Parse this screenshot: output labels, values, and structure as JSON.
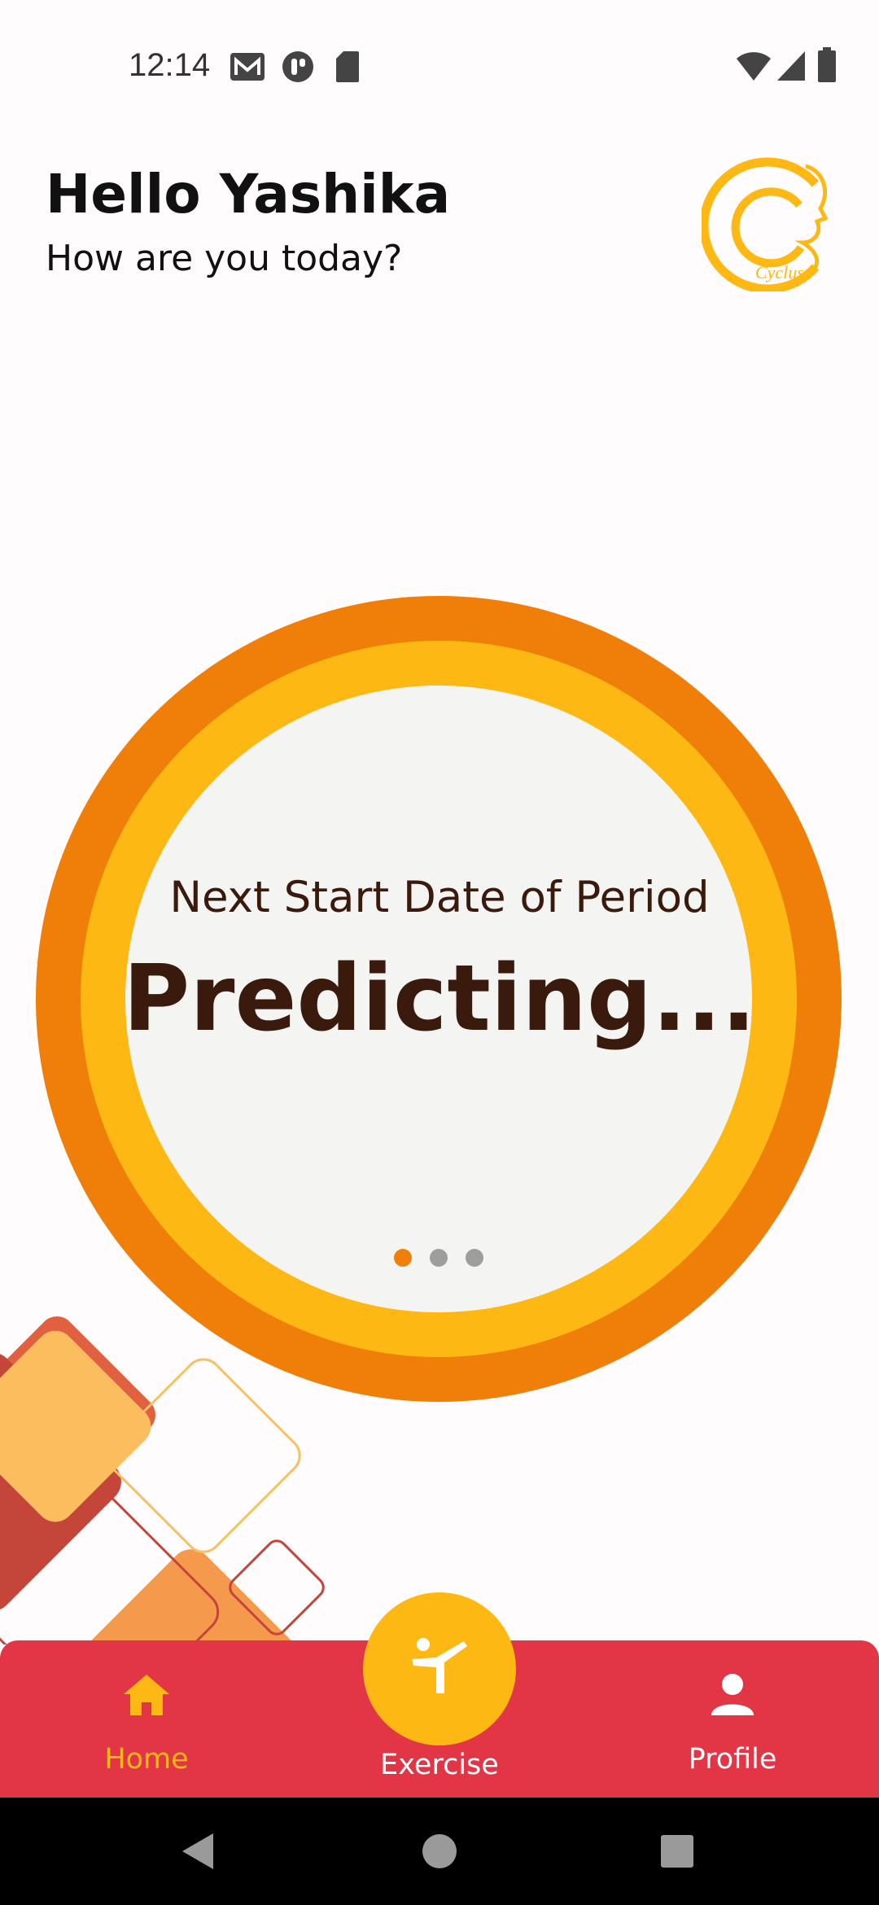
{
  "status_bar": {
    "time": "12:14",
    "left_icons": [
      "gmail-icon",
      "app-notification-icon",
      "sd-card-icon"
    ],
    "right_icons": [
      "wifi-icon",
      "cell-signal-icon",
      "battery-icon"
    ]
  },
  "header": {
    "title": "Hello Yashika",
    "subtitle": "How are you today?",
    "logo_text": "Cyclus"
  },
  "prediction_card": {
    "label": "Next Start Date of Period",
    "value": "Predicting...",
    "pager_dots": 3,
    "active_dot": 0
  },
  "bottom_nav": {
    "items": [
      {
        "label": "Home",
        "icon": "home-icon",
        "active": true
      },
      {
        "label": "Exercise",
        "icon": "exercise-icon",
        "active": false
      },
      {
        "label": "Profile",
        "icon": "person-icon",
        "active": false
      }
    ]
  },
  "system_nav": [
    "back-icon",
    "home-circle-icon",
    "recents-icon"
  ],
  "colors": {
    "orange": "#f07f09",
    "yellow": "#fdb813",
    "nav_red": "#e23546",
    "text_brown": "#3a1a0c"
  }
}
